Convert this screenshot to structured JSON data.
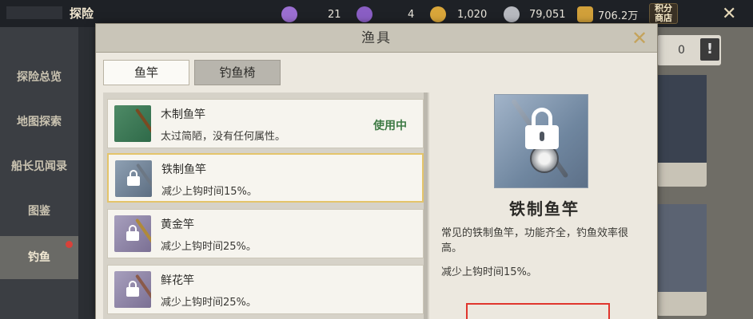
{
  "topbar": {
    "title": "探险",
    "resources": [
      {
        "icon": "purple-gem-plus-icon",
        "value": "21",
        "color": "#9b6fd1"
      },
      {
        "icon": "purple-gem-badge-icon",
        "value": "4",
        "color": "#8a5ec4"
      },
      {
        "icon": "gold-coin-plus-icon",
        "value": "1,020",
        "color": "#d9a63a"
      },
      {
        "icon": "silver-coin-plus-icon",
        "value": "79,051",
        "color": "#b7b9bf"
      },
      {
        "icon": "gold-ingot-plus-icon",
        "value": "706.2万",
        "color": "#d1a03a"
      }
    ],
    "shop_label": "积分\n商店"
  },
  "left_menu": {
    "items": [
      {
        "label": "探险总览"
      },
      {
        "label": "地图探索"
      },
      {
        "label": "船长见闻录"
      },
      {
        "label": "图鉴"
      },
      {
        "label": "钓鱼",
        "active": true,
        "badge": true
      }
    ]
  },
  "right_panel": {
    "count": "0",
    "alert": "!"
  },
  "modal": {
    "title": "渔具",
    "tabs": [
      {
        "label": "鱼竿",
        "active": true
      },
      {
        "label": "钓鱼椅",
        "active": false
      }
    ],
    "items": [
      {
        "name": "木制鱼竿",
        "desc": "太过简陋，没有任何属性。",
        "status": "使用中",
        "locked": false
      },
      {
        "name": "铁制鱼竿",
        "desc": "减少上钩时间15%。",
        "status": "",
        "locked": true,
        "selected": true
      },
      {
        "name": "黄金竿",
        "desc": "减少上钩时间25%。",
        "status": "",
        "locked": true
      },
      {
        "name": "鲜花竿",
        "desc": "减少上钩时间25%。",
        "status": "",
        "locked": true
      }
    ],
    "detail": {
      "name": "铁制鱼竿",
      "description": "常见的铁制鱼竿，功能齐全，钓鱼效率很高。",
      "effect": "减少上钩时间15%。"
    }
  }
}
